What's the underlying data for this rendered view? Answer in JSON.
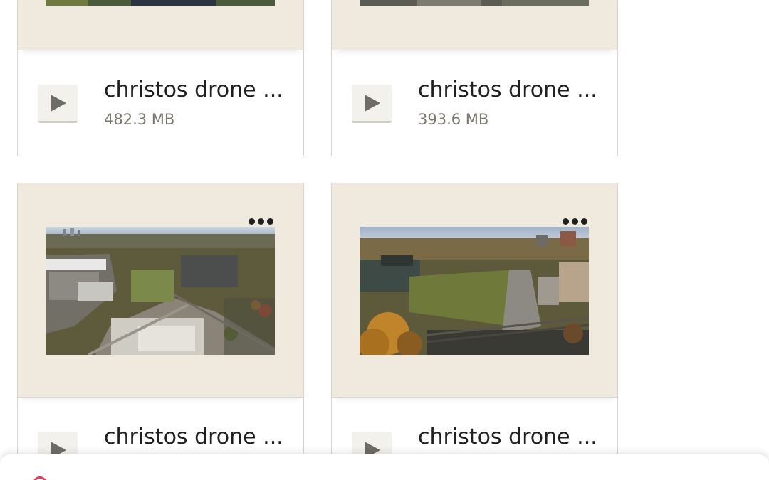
{
  "files": [
    {
      "name": "christos drone ...",
      "size": "482.3 MB"
    },
    {
      "name": "christos drone ...",
      "size": "393.6 MB"
    },
    {
      "name": "christos drone ...",
      "size": ""
    },
    {
      "name": "christos drone ...",
      "size": ""
    }
  ],
  "colors": {
    "card_thumb_bg": "#f0e9dd",
    "card_border": "#d9d6d0",
    "title_text": "#1f1f1f",
    "size_text": "#7a766f"
  },
  "icons": {
    "play": "play-icon",
    "more": "more-options-icon"
  }
}
